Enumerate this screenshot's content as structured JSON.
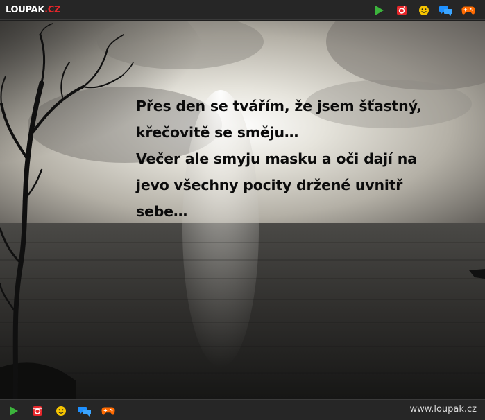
{
  "header": {
    "logo_text": "LOUPAK",
    "logo_tld": ".CZ",
    "icons": [
      "play-icon",
      "instagram-icon",
      "smiley-icon",
      "chat-icon",
      "gamepad-icon"
    ]
  },
  "post": {
    "quote_lines": [
      "Přes den se tvářím, že jsem šťastný,",
      "křečovitě se směju…",
      "Večer ale smyju masku a oči dají na",
      "jevo všechny pocity držené uvnitř",
      "sebe…"
    ]
  },
  "footer": {
    "icons": [
      "play-icon",
      "instagram-icon",
      "smiley-icon",
      "chat-icon",
      "gamepad-icon"
    ],
    "site_url": "www.loupak.cz"
  },
  "colors": {
    "bar_bg": "#262626",
    "play": "#3cb43c",
    "instagram": "#e8262a",
    "smiley": "#f5c400",
    "chat": "#1e90ff",
    "gamepad": "#ff6a00",
    "logo_accent": "#e8262a"
  }
}
